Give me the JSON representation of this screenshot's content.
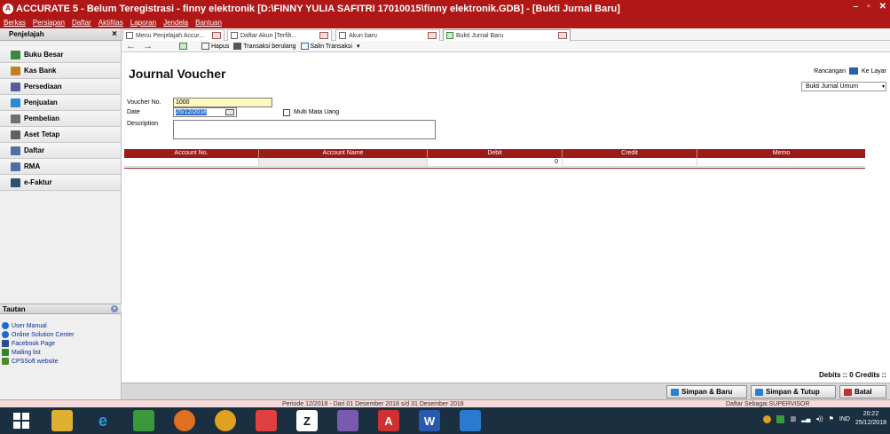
{
  "window": {
    "title": "ACCURATE 5 - Belum Teregistrasi - finny elektronik   [D:\\FINNY YULIA SAFITRI 17010015\\finny elektronik.GDB] - [Bukti Jurnal Baru]",
    "app_icon": "accurate-logo-icon",
    "controls": [
      "minimize-icon",
      "restore-icon",
      "close-icon"
    ]
  },
  "menu": {
    "items": [
      "Berkas",
      "Persiapan",
      "Daftar",
      "Aktifitas",
      "Laporan",
      "Jendela",
      "Bantuan"
    ]
  },
  "sidebar": {
    "header": "Penjelajah",
    "close": "×",
    "items": [
      {
        "label": "Buku Besar",
        "icon": "ledger-icon",
        "color": "#3a8a3a"
      },
      {
        "label": "Kas Bank",
        "icon": "bank-icon",
        "color": "#c08020"
      },
      {
        "label": "Persediaan",
        "icon": "inventory-icon",
        "color": "#5a5aa0"
      },
      {
        "label": "Penjualan",
        "icon": "sales-icon",
        "color": "#2a8ad0"
      },
      {
        "label": "Pembelian",
        "icon": "cart-icon",
        "color": "#707070"
      },
      {
        "label": "Aset Tetap",
        "icon": "building-icon",
        "color": "#606060"
      },
      {
        "label": "Daftar",
        "icon": "list-icon",
        "color": "#4a70a8"
      },
      {
        "label": "RMA",
        "icon": "rma-icon",
        "color": "#4a70a8"
      },
      {
        "label": "e-Faktur",
        "icon": "efaktur-icon",
        "color": "#30506a"
      }
    ],
    "tautan": {
      "header": "Tautan",
      "links": [
        {
          "label": "User Manual",
          "icon": "help-icon",
          "color": "#1a6ad0"
        },
        {
          "label": "Online Solution Center",
          "icon": "help-icon",
          "color": "#1a6ad0"
        },
        {
          "label": "Facebook Page",
          "icon": "facebook-icon",
          "color": "#2a4a9a"
        },
        {
          "label": "Mailing list",
          "icon": "mail-icon",
          "color": "#2a8a2a"
        },
        {
          "label": "CPSSoft website",
          "icon": "web-icon",
          "color": "#4a8a2a"
        }
      ]
    }
  },
  "tabs": [
    {
      "label": "Menu Penjelajah Accur...",
      "icon": "page-icon"
    },
    {
      "label": "Daftar Akun [Terfilt...",
      "icon": "grid-icon"
    },
    {
      "label": "Akun baru",
      "icon": "page-icon"
    },
    {
      "label": "Bukti Jurnal Baru",
      "icon": "journal-icon"
    }
  ],
  "toolbar": {
    "back": "back-arrow-icon",
    "forward": "forward-arrow-icon",
    "hapus": "Hapus",
    "transaksi_berulang": "Transaksi berulang",
    "salin_transaksi": "Salin Transaksi"
  },
  "form": {
    "title": "Journal Voucher",
    "rancangan_label": "Rancangan",
    "ke_layar": "Ke Layar",
    "template": "Bukti Jurnal Umum",
    "voucher_label": "Voucher No.",
    "voucher_value": "1000",
    "date_label": "Date",
    "date_value": "25/12/2018",
    "multi_currency_label": "Multi Mata Uang",
    "description_label": "Description",
    "description_value": ""
  },
  "grid": {
    "columns": [
      "Account No.",
      "Account Name",
      "Debit",
      "Credit",
      "Memo"
    ],
    "rows": [
      {
        "account_no": "",
        "account_name": "",
        "debit": "0",
        "credit": "",
        "memo": ""
      }
    ]
  },
  "totals": {
    "text": "Debits :: 0   Credits ::"
  },
  "buttons": {
    "simpan_baru": "Simpan & Baru",
    "simpan_tutup": "Simpan & Tutup",
    "batal": "Batal"
  },
  "status": {
    "periode": "Periode 12/2018 - Dari 01 Desember 2018 s/d 31 Desember 2018",
    "user": "Daftar Sebagai SUPERVISOR"
  },
  "taskbar": {
    "lang": "IND",
    "time": "20:22",
    "date": "25/12/2018"
  },
  "colors": {
    "accent": "#b01818",
    "grid_header": "#9b1a1a"
  }
}
